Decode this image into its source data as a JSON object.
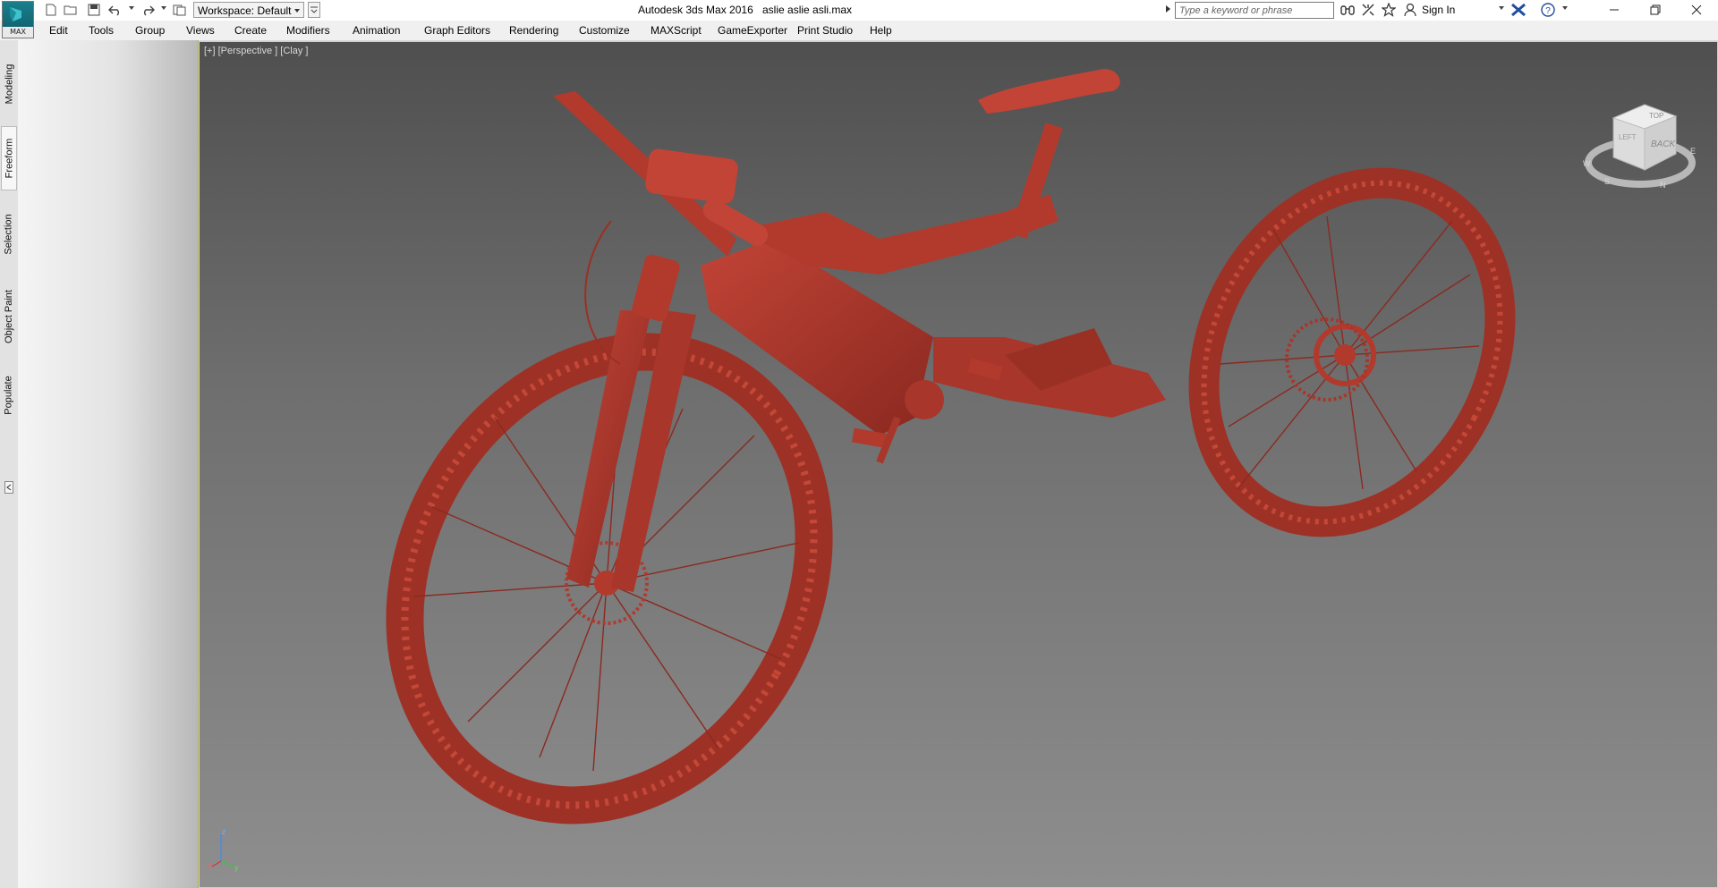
{
  "app": {
    "logo_text": "MAX",
    "title": "Autodesk 3ds Max 2016",
    "file_name": "aslie aslie asli.max"
  },
  "quick_access": {
    "icons": [
      "new-file-icon",
      "open-file-icon",
      "save-icon",
      "undo-icon",
      "redo-icon",
      "project-folder-icon"
    ],
    "workspace_label": "Workspace: Default"
  },
  "infocenter": {
    "search_placeholder": "Type a keyword or phrase",
    "sign_in_label": "Sign In"
  },
  "menu": {
    "items": [
      "Edit",
      "Tools",
      "Group",
      "Views",
      "Create",
      "Modifiers",
      "Animation",
      "Graph Editors",
      "Rendering",
      "Customize",
      "MAXScript",
      "GameExporter",
      "Print Studio",
      "Help"
    ]
  },
  "ribbon_tabs": {
    "items": [
      "Modeling",
      "Freeform",
      "Selection",
      "Object Paint",
      "Populate"
    ],
    "active": "Freeform"
  },
  "viewport": {
    "label": "[+] [Perspective ] [Clay ]",
    "border_color": "#e8e030",
    "model_color": "#b13a2d"
  },
  "viewcube": {
    "top_label": "TOP",
    "back_label": "BACK",
    "left_label": "LEFT",
    "compass": [
      "W",
      "S",
      "E",
      "N"
    ]
  },
  "axis": {
    "x": "x",
    "y": "y",
    "z": "z"
  }
}
